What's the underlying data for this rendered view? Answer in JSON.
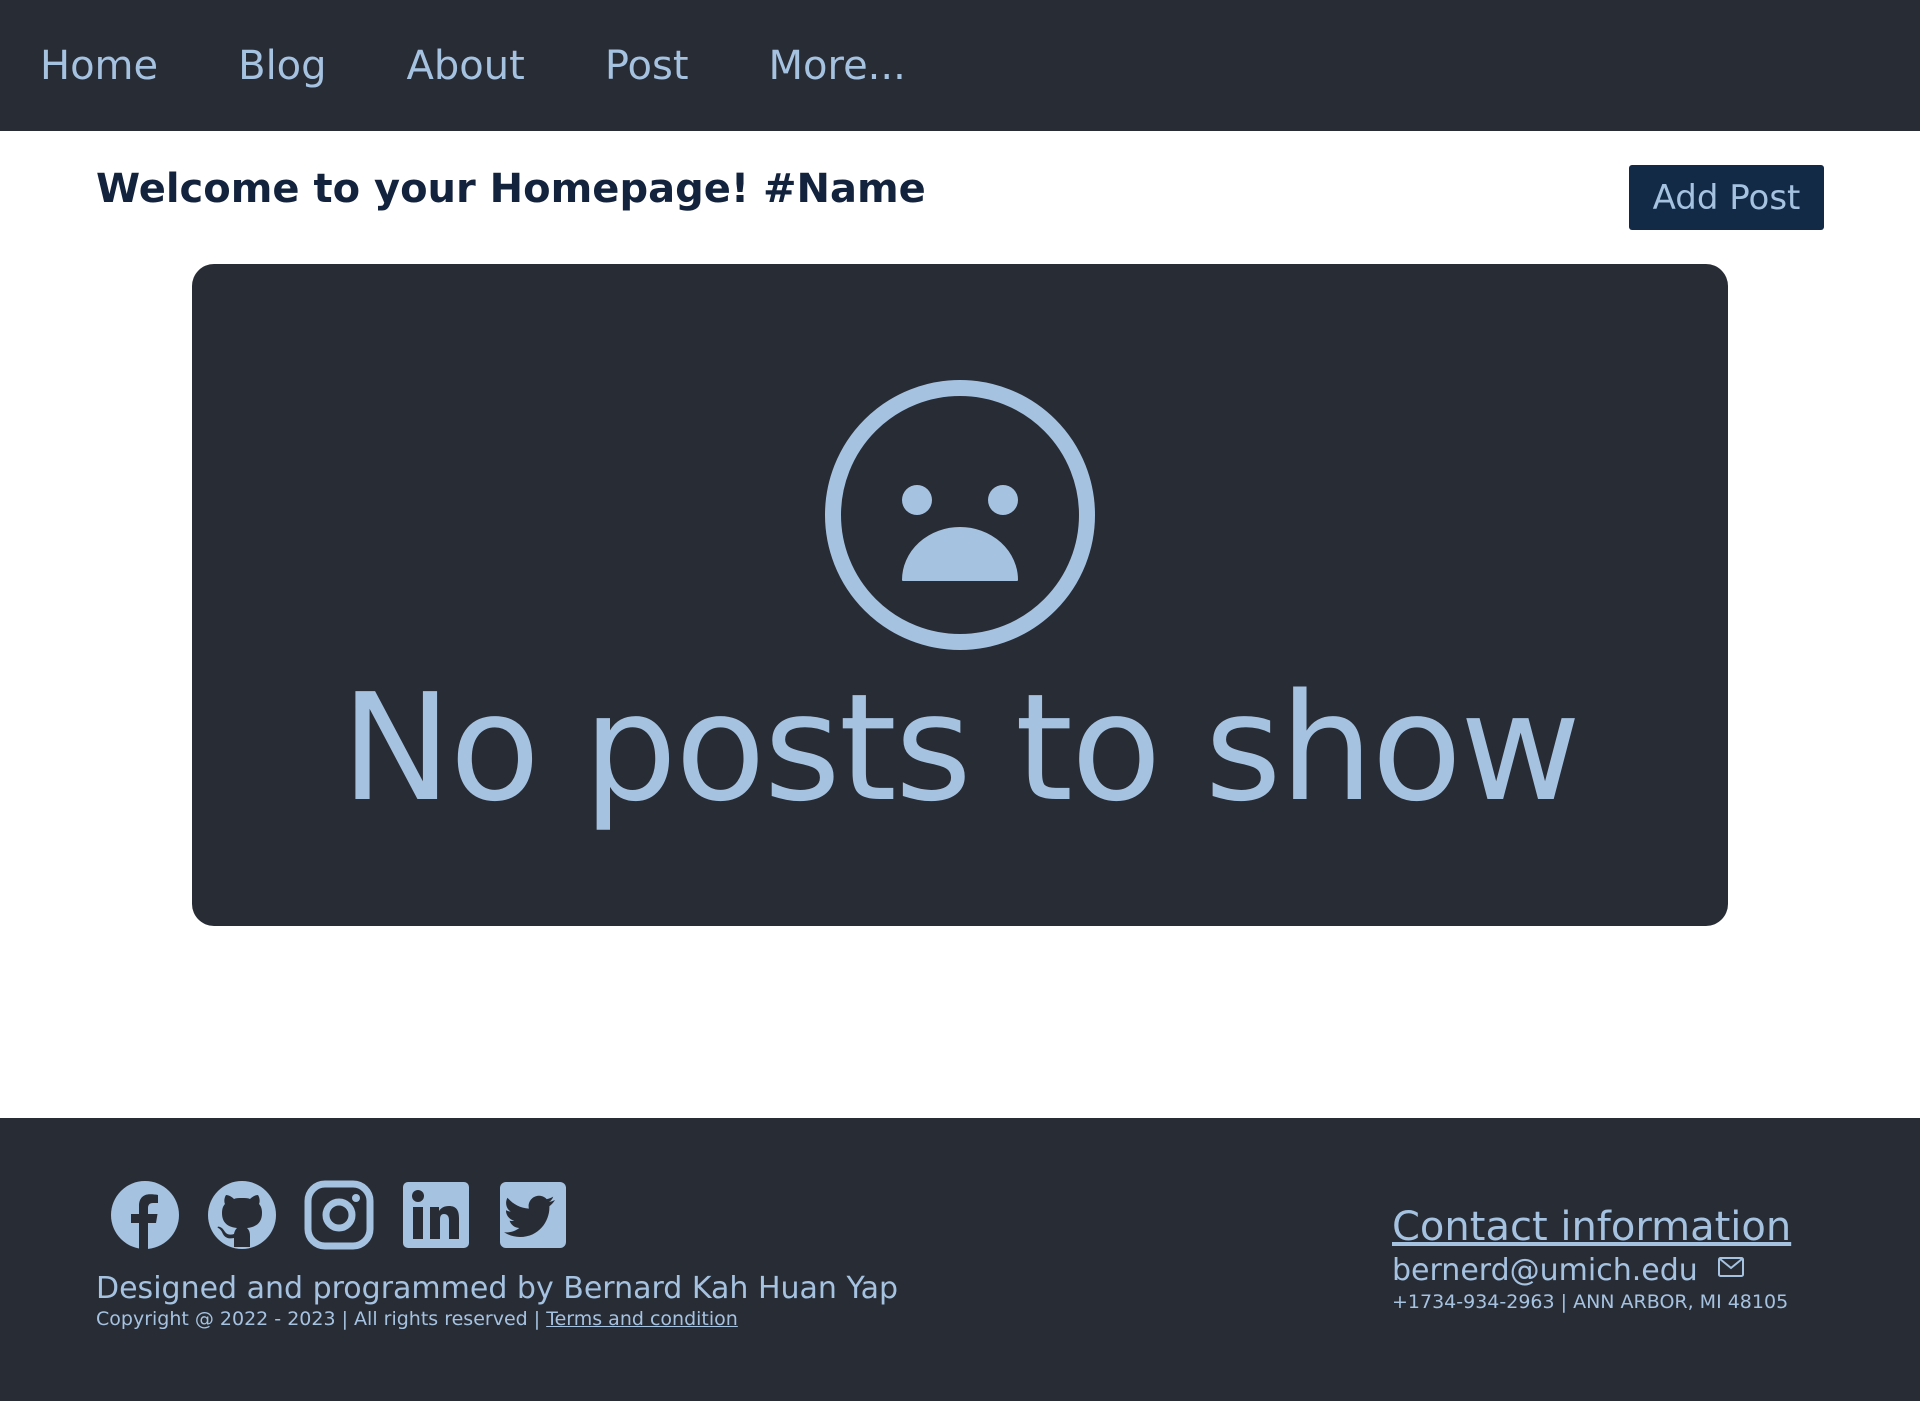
{
  "nav": {
    "items": [
      {
        "label": "Home"
      },
      {
        "label": "Blog"
      },
      {
        "label": "About"
      },
      {
        "label": "Post"
      },
      {
        "label": "More..."
      }
    ]
  },
  "header": {
    "welcome": "Welcome to your Homepage! #Name",
    "add_post_label": "Add Post"
  },
  "empty_state": {
    "icon": "sad-face-icon",
    "message": "No posts to show"
  },
  "footer": {
    "socials": [
      {
        "icon": "facebook-icon"
      },
      {
        "icon": "github-icon"
      },
      {
        "icon": "instagram-icon"
      },
      {
        "icon": "linkedin-icon"
      },
      {
        "icon": "twitter-icon"
      }
    ],
    "designed_by": "Designed and programmed by Bernard Kah Huan Yap",
    "copyright": "Copyright @ 2022 - 2023 | All rights reserved | ",
    "terms_label": "Terms and condition",
    "contact_title": "Contact information",
    "email": "bernerd@umich.edu",
    "address": "+1734-934-2963 | ANN ARBOR, MI 48105"
  },
  "colors": {
    "dark_bg": "#282c35",
    "accent_text": "#a5c2e1",
    "button_bg": "#132a47",
    "heading_text": "#13233d"
  }
}
